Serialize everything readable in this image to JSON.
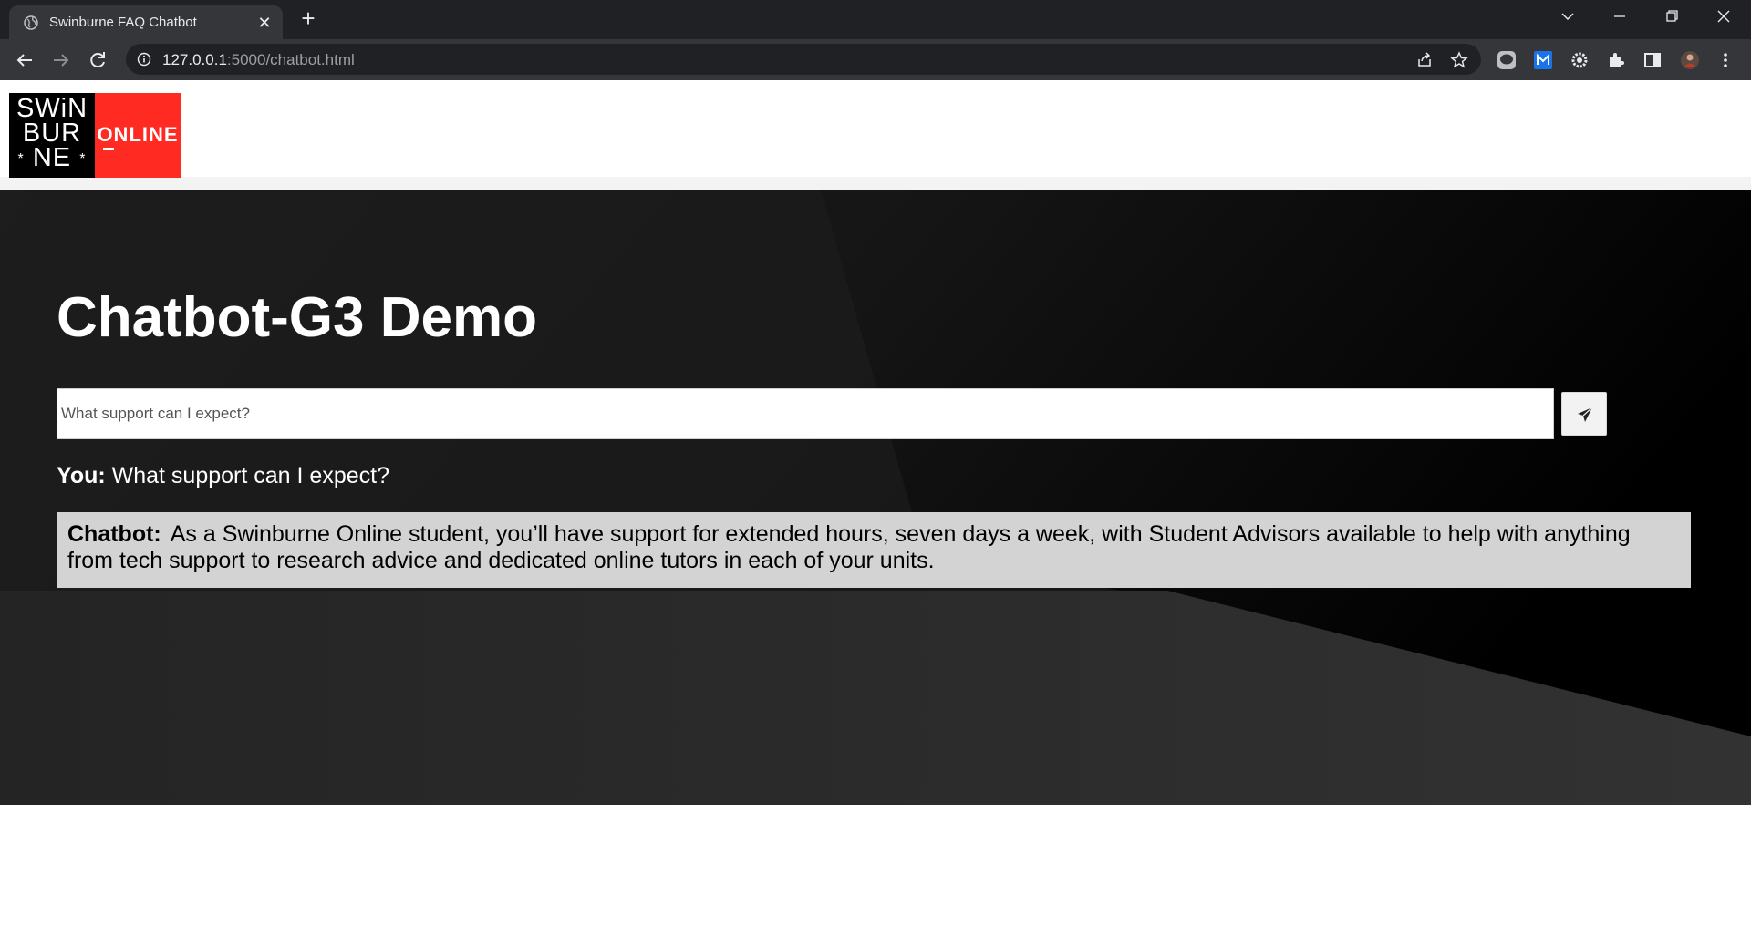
{
  "browser": {
    "tab_title": "Swinburne FAQ Chatbot",
    "url_host": "127.0.0.1",
    "url_path": ":5000/chatbot.html"
  },
  "logo": {
    "line1": "SWiN",
    "line2": "BUR",
    "line3": "NE",
    "star_left": "*",
    "star_right": "*",
    "online": "ONLINE"
  },
  "page": {
    "title": "Chatbot-G3 Demo",
    "input_placeholder": "What support can I expect?"
  },
  "conversation": {
    "user_label": "You:",
    "user_message": "What support can I expect?",
    "bot_label": "Chatbot:",
    "bot_message": "As a Swinburne Online student, you’ll have support for extended hours, seven days a week, with Student Advisors available to help with anything from tech support to research advice and dedicated online tutors in each of your units."
  },
  "icons": {
    "tab": "globe-icon",
    "send": "paper-plane-icon"
  },
  "colors": {
    "brand_red": "#ff2a22",
    "hero_dark": "#1c1c1c",
    "chat_bubble": "#d3d3d3"
  }
}
